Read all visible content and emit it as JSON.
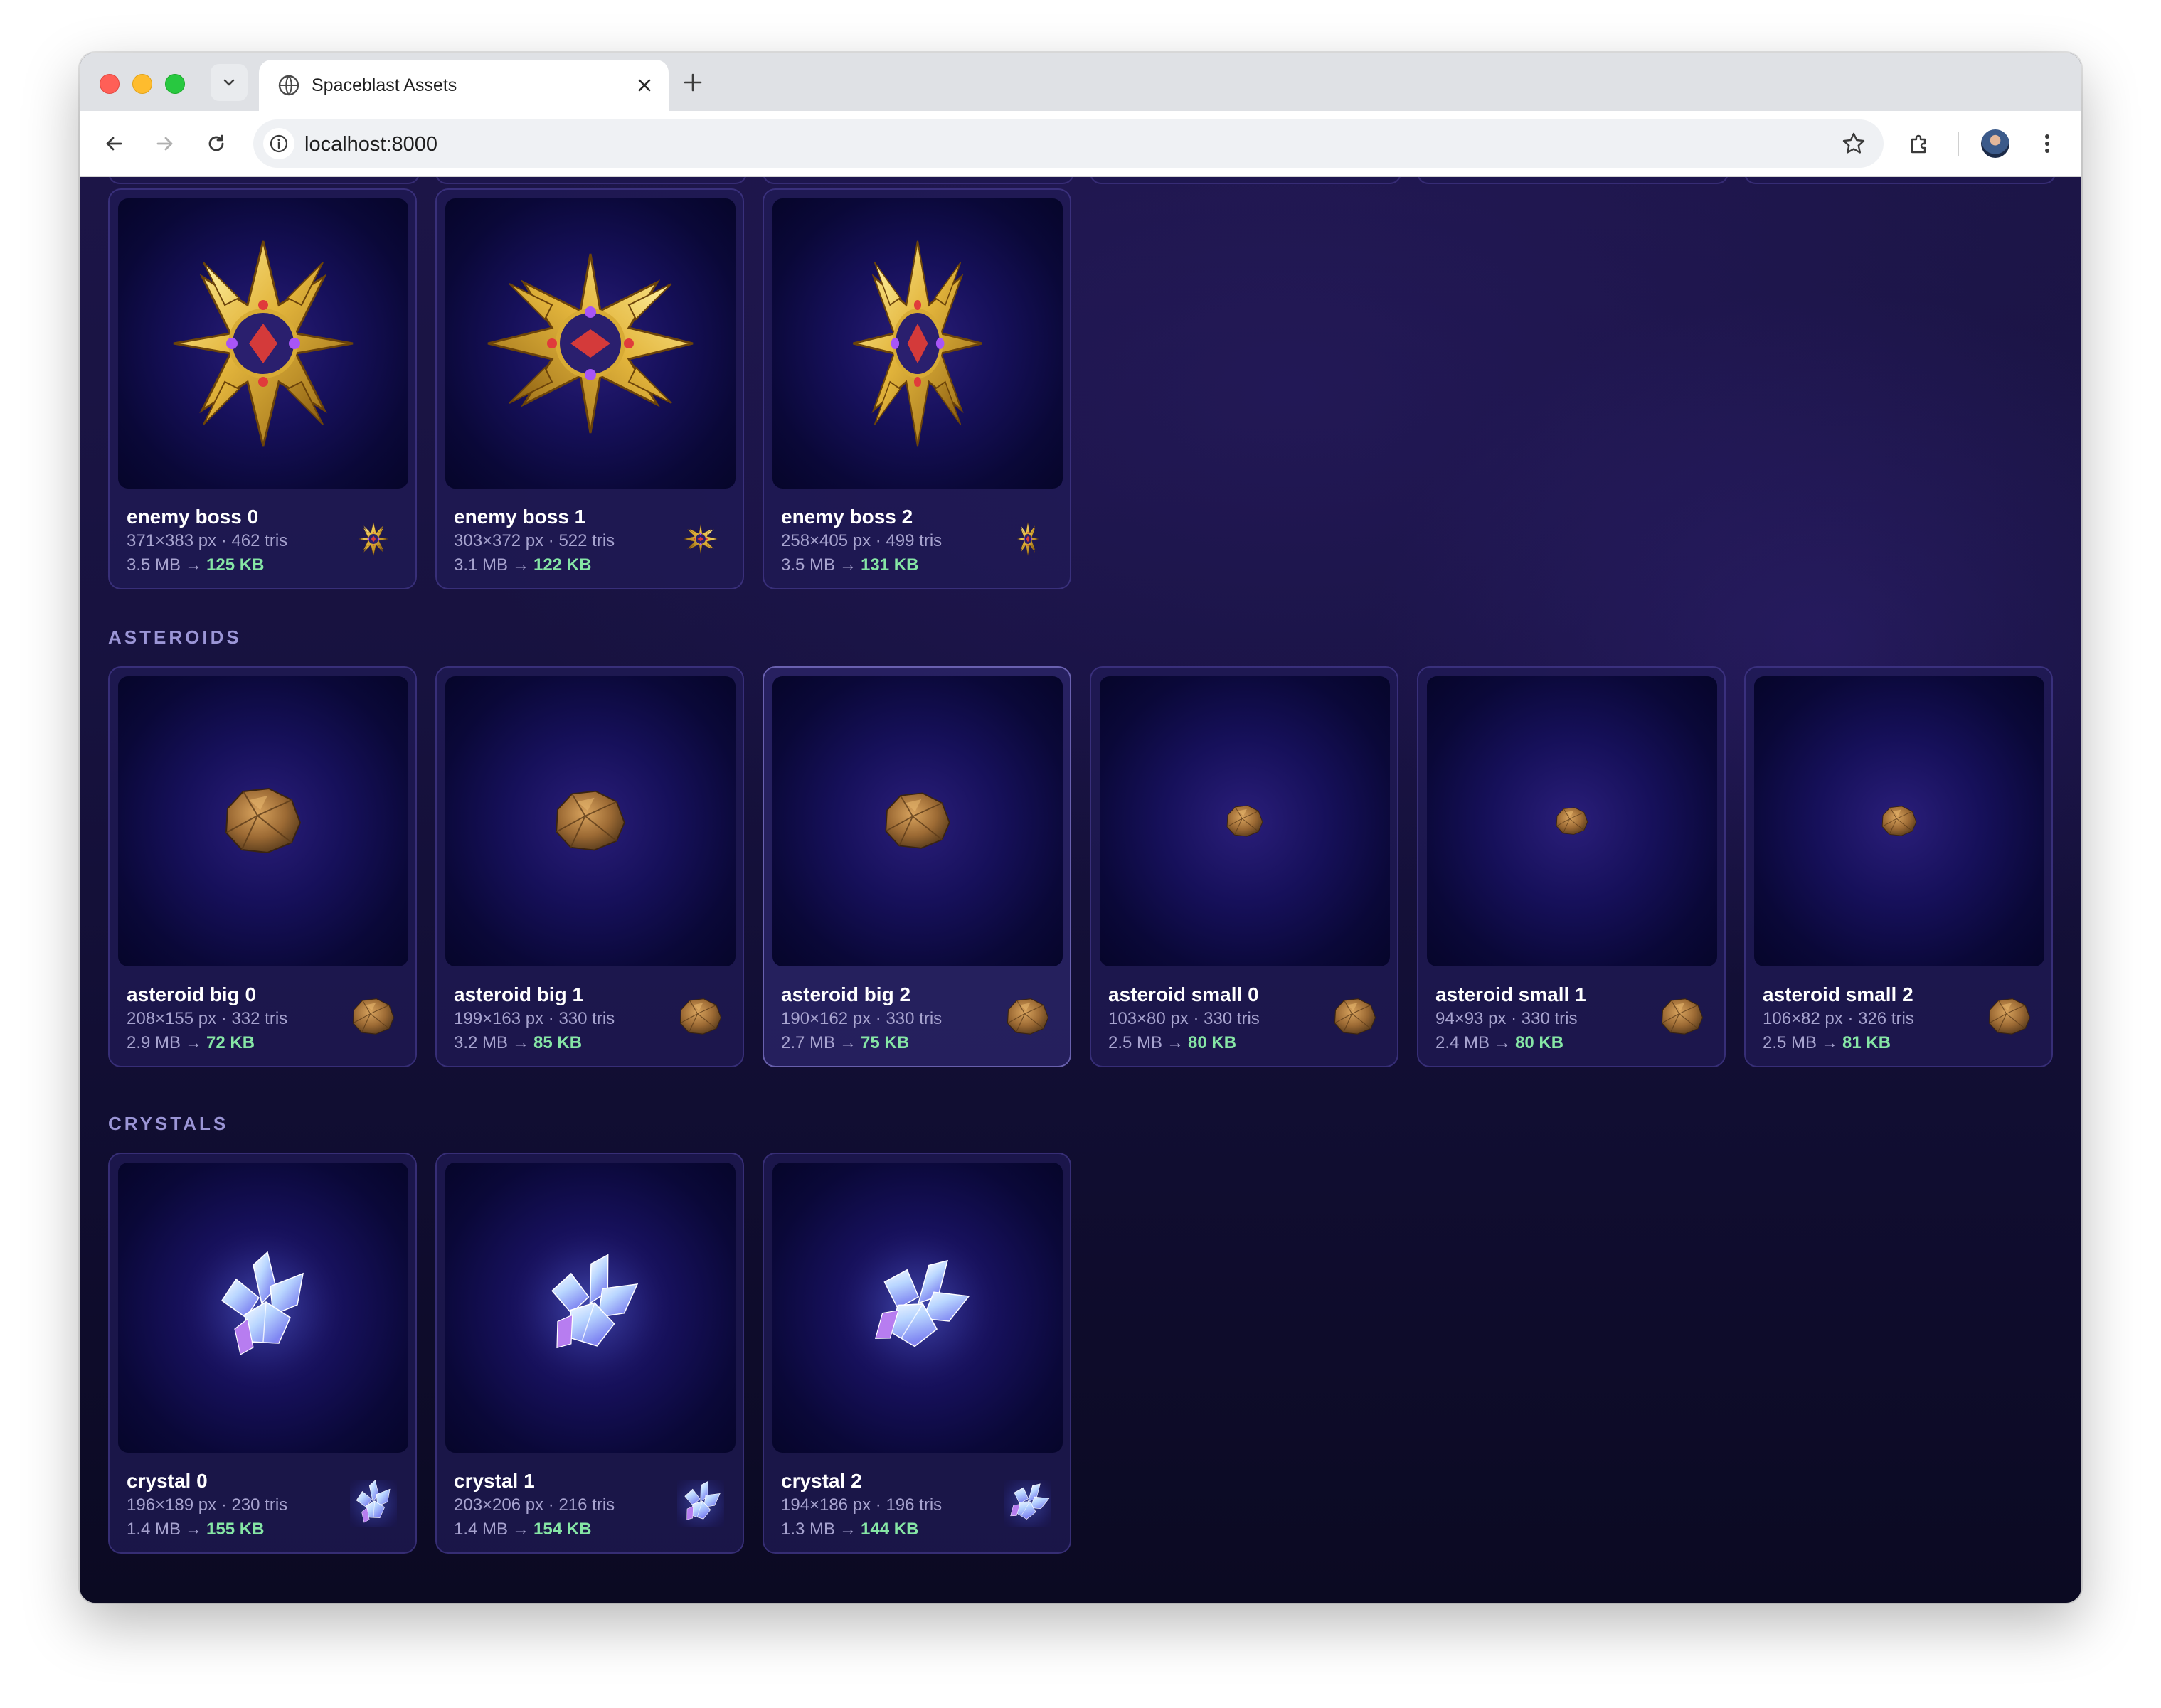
{
  "browser": {
    "tab_title": "Spaceblast Assets",
    "url": "localhost:8000"
  },
  "sections": [
    {
      "title": "",
      "cards": [
        {
          "name": "enemy boss 0",
          "meta": "371×383 px · 462 tris",
          "size_in": "3.5 MB",
          "size_out": "125 KB",
          "icon": "boss-icon"
        },
        {
          "name": "enemy boss 1",
          "meta": "303×372 px · 522 tris",
          "size_in": "3.1 MB",
          "size_out": "122 KB",
          "icon": "boss-icon"
        },
        {
          "name": "enemy boss 2",
          "meta": "258×405 px · 499 tris",
          "size_in": "3.5 MB",
          "size_out": "131 KB",
          "icon": "boss-icon"
        }
      ]
    },
    {
      "title": "ASTEROIDS",
      "cards": [
        {
          "name": "asteroid big 0",
          "meta": "208×155 px · 332 tris",
          "size_in": "2.9 MB",
          "size_out": "72 KB",
          "icon": "asteroid-icon"
        },
        {
          "name": "asteroid big 1",
          "meta": "199×163 px · 330 tris",
          "size_in": "3.2 MB",
          "size_out": "85 KB",
          "icon": "asteroid-icon"
        },
        {
          "name": "asteroid big 2",
          "meta": "190×162 px · 330 tris",
          "size_in": "2.7 MB",
          "size_out": "75 KB",
          "icon": "asteroid-icon"
        },
        {
          "name": "asteroid small 0",
          "meta": "103×80 px · 330 tris",
          "size_in": "2.5 MB",
          "size_out": "80 KB",
          "icon": "asteroid-icon"
        },
        {
          "name": "asteroid small 1",
          "meta": "94×93 px · 330 tris",
          "size_in": "2.4 MB",
          "size_out": "80 KB",
          "icon": "asteroid-icon"
        },
        {
          "name": "asteroid small 2",
          "meta": "106×82 px · 326 tris",
          "size_in": "2.5 MB",
          "size_out": "81 KB",
          "icon": "asteroid-icon"
        }
      ]
    },
    {
      "title": "CRYSTALS",
      "cards": [
        {
          "name": "crystal 0",
          "meta": "196×189 px · 230 tris",
          "size_in": "1.4 MB",
          "size_out": "155 KB",
          "icon": "crystal-icon"
        },
        {
          "name": "crystal 1",
          "meta": "203×206 px · 216 tris",
          "size_in": "1.4 MB",
          "size_out": "154 KB",
          "icon": "crystal-icon"
        },
        {
          "name": "crystal 2",
          "meta": "194×186 px · 196 tris",
          "size_in": "1.3 MB",
          "size_out": "144 KB",
          "icon": "crystal-icon"
        }
      ]
    }
  ],
  "colors": {
    "page_bg": "#17123f",
    "card_border": "#5e53b0",
    "compressed_size": "#86e6a5",
    "section_title": "#9b95d6"
  }
}
